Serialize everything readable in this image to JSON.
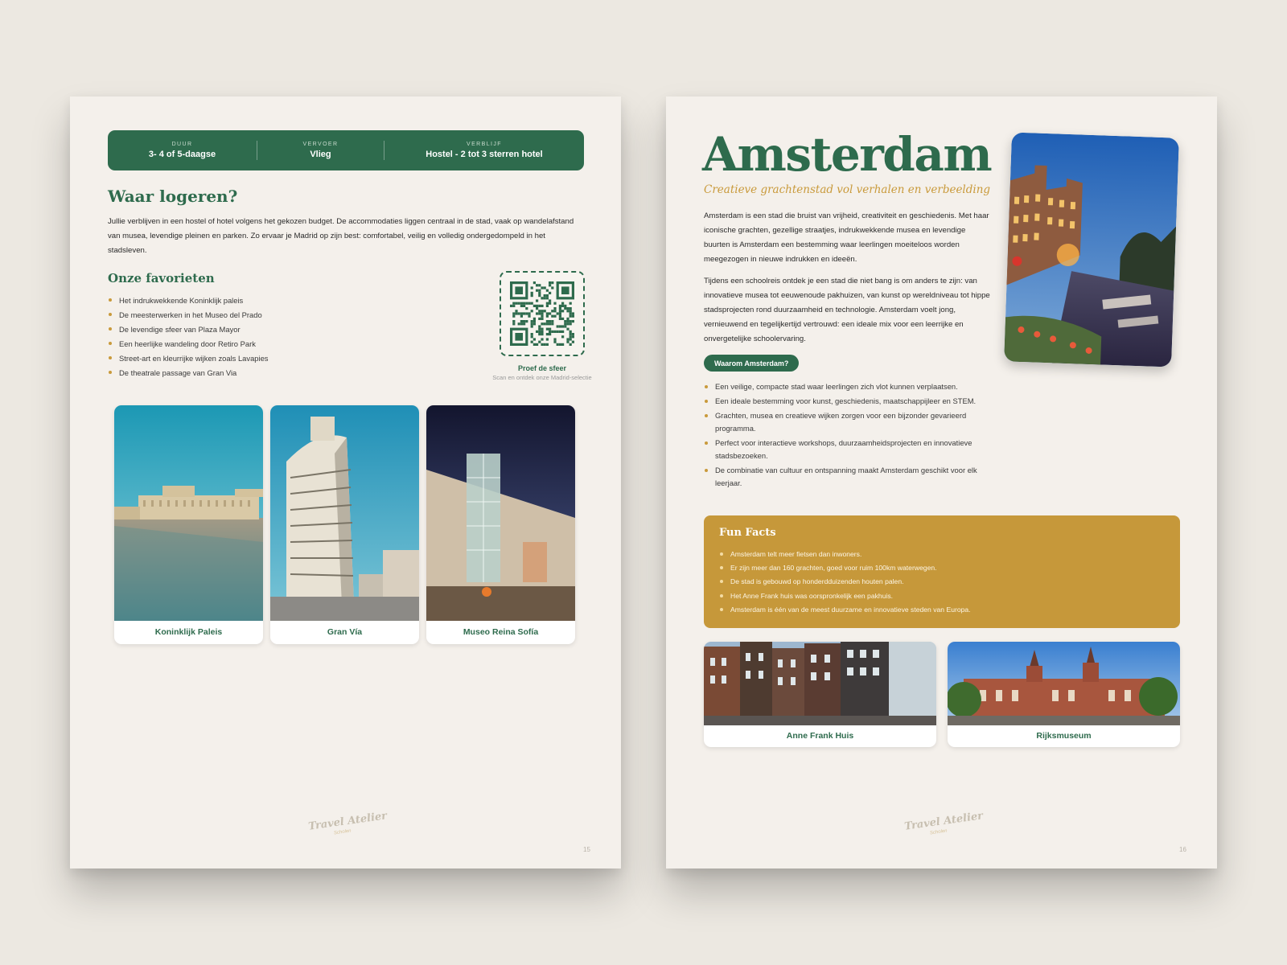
{
  "left_page": {
    "infobar": [
      {
        "caption": "Duur",
        "value": "3- 4 of 5-daagse"
      },
      {
        "caption": "Vervoer",
        "value": "Vlieg"
      },
      {
        "caption": "Verblijf",
        "value": "Hostel - 2 tot 3 sterren hotel"
      }
    ],
    "lodging_title": "Waar logeren?",
    "lodging_text": "Jullie verblijven in een hostel of hotel volgens het gekozen budget. De accommodaties liggen centraal in de stad, vaak op wandelafstand van musea, levendige pleinen en parken. Zo ervaar je Madrid op zijn best: comfortabel, veilig en volledig ondergedompeld in het stadsleven.",
    "favorites_title": "Onze favorieten",
    "favorites": [
      "Het indrukwekkende Koninklijk paleis",
      "De meesterwerken in het Museo del Prado",
      "De levendige sfeer van Plaza Mayor",
      "Een heerlijke wandeling door Retiro Park",
      "Street-art en kleurrijke wijken zoals Lavapies",
      "De theatrale passage van Gran Via"
    ],
    "qr_title": "Proef de sfeer",
    "qr_subtitle": "Scan en ontdek onze Madrid-selectie",
    "photos": [
      {
        "caption": "Koninklijk Paleis"
      },
      {
        "caption": "Gran Vía"
      },
      {
        "caption": "Museo Reina Sofía"
      }
    ],
    "page_number": "15"
  },
  "right_page": {
    "title": "Amsterdam",
    "subtitle": "Creatieve grachtenstad vol verhalen en verbeelding",
    "paragraph1": "Amsterdam is een stad die bruist van vrijheid, creativiteit en geschiedenis. Met haar iconische grachten, gezellige straatjes, indrukwekkende musea en levendige buurten is Amsterdam een bestemming waar leerlingen moeiteloos worden meegezogen in nieuwe indrukken en ideeën.",
    "paragraph2": "Tijdens een schoolreis ontdek je een stad die niet bang is om anders te zijn: van innovatieve musea tot eeuwenoude pakhuizen, van kunst op wereldniveau tot hippe stadsprojecten rond duurzaamheid en technologie. Amsterdam voelt jong, vernieuwend en tegelijkertijd vertrouwd: een ideale mix voor een leerrijke en onvergetelijke schoolervaring.",
    "why_label": "Waarom Amsterdam?",
    "why_items": [
      "Een veilige, compacte stad waar leerlingen zich vlot kunnen verplaatsen.",
      "Een ideale bestemming voor kunst, geschiedenis, maatschappijleer en STEM.",
      "Grachten, musea en creatieve wijken zorgen voor een bijzonder gevarieerd programma.",
      "Perfect voor interactieve workshops, duurzaamheidsprojecten en innovatieve stadsbezoeken.",
      "De combinatie van cultuur en ontspanning maakt Amsterdam geschikt voor elk leerjaar."
    ],
    "funfacts_title": "Fun Facts",
    "funfacts": [
      "Amsterdam telt meer fietsen dan inwoners.",
      "Er zijn meer dan 160 grachten, goed voor ruim 100km waterwegen.",
      "De stad is gebouwd op honderdduizenden houten palen.",
      "Het Anne Frank huis was oorspronkelijk een pakhuis.",
      "Amsterdam is één van de meest duurzame en innovatieve steden van Europa."
    ],
    "photos": [
      {
        "caption": "Anne Frank Huis"
      },
      {
        "caption": "Rijksmuseum"
      }
    ],
    "page_number": "16"
  },
  "logo": {
    "line1": "Travel Atelier",
    "line2": "Scholen"
  },
  "colors": {
    "green": "#2e6b4d",
    "gold": "#c99a3b",
    "paper": "#f4f0eb"
  }
}
